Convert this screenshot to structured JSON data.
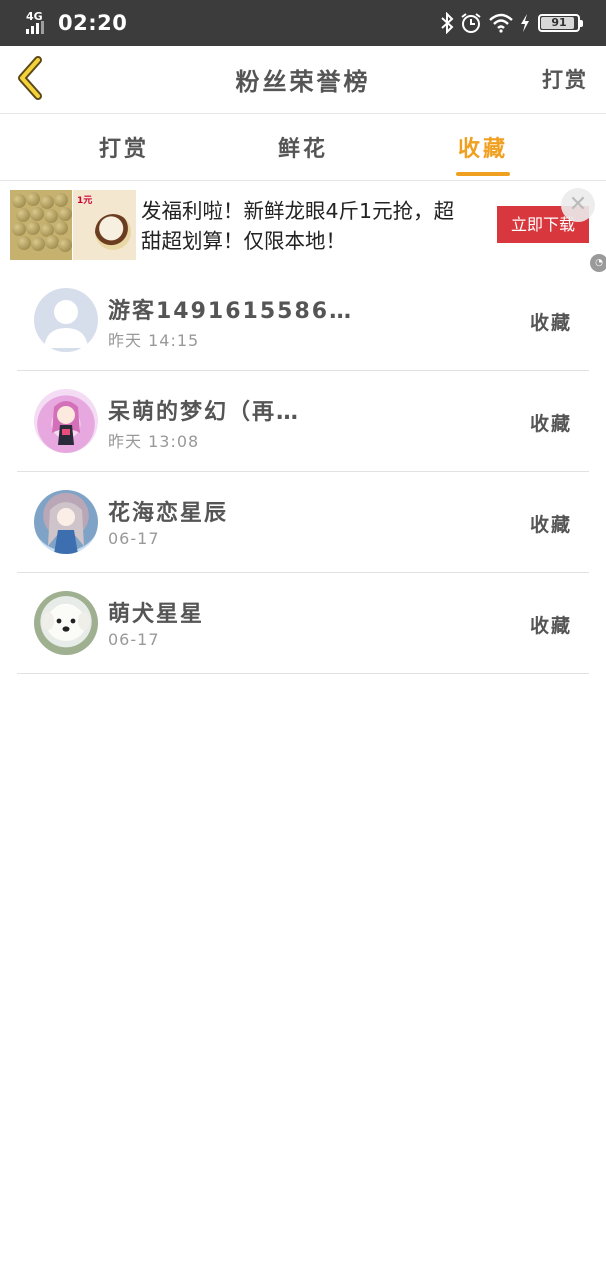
{
  "status_bar": {
    "network": "4G",
    "time": "02:20",
    "battery": "91",
    "battery_level": 0.91
  },
  "header": {
    "title": "粉丝荣誉榜",
    "action": "打赏"
  },
  "tabs": [
    {
      "label": "打赏",
      "active": false
    },
    {
      "label": "鲜花",
      "active": false
    },
    {
      "label": "收藏",
      "active": true
    }
  ],
  "ad": {
    "text": "发福利啦！新鲜龙眼4斤1元抢，超甜超划算！仅限本地！",
    "cta": "立即下载",
    "image_tag": "1元"
  },
  "list": [
    {
      "name": "游客1491615586…",
      "time": "昨天 14:15",
      "action": "收藏",
      "avatar": "guest-avatar"
    },
    {
      "name": "呆萌的梦幻（再…",
      "time": "昨天 13:08",
      "action": "收藏",
      "avatar": "anime-avatar"
    },
    {
      "name": "花海恋星辰",
      "time": "06-17",
      "action": "收藏",
      "avatar": "anime-avatar"
    },
    {
      "name": "萌犬星星",
      "time": "06-17",
      "action": "收藏",
      "avatar": "dog-avatar"
    }
  ],
  "colors": {
    "accent": "#f0a020",
    "status_bar": "#3c3c3c",
    "ad_button": "#d8383d"
  }
}
